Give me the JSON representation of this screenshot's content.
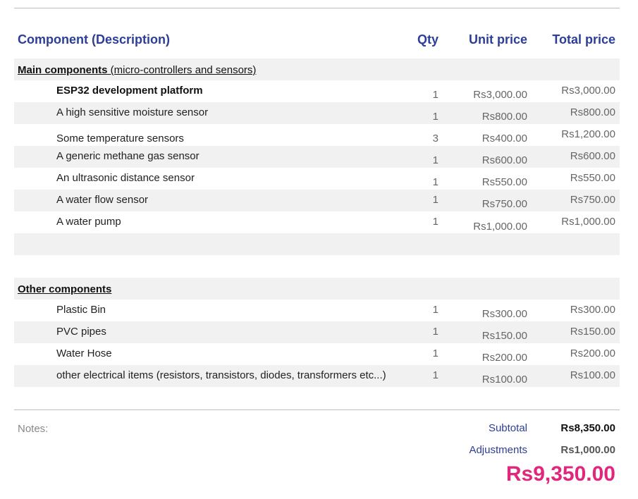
{
  "header": {
    "description": "Component (Description)",
    "qty": "Qty",
    "unit_price": "Unit price",
    "total_price": "Total price"
  },
  "sections": [
    {
      "title_bold": "Main components",
      "title_rest": " (micro-controllers and sensors)",
      "items": [
        {
          "description": "ESP32 development platform",
          "qty": "1",
          "unit": "Rs3,000.00",
          "total": "Rs3,000.00"
        },
        {
          "description": "A high sensitive moisture sensor",
          "qty": "1",
          "unit": "Rs800.00",
          "total": "Rs800.00"
        },
        {
          "description": "Some temperature sensors",
          "qty": "3",
          "unit": "Rs400.00",
          "total": "Rs1,200.00"
        },
        {
          "description": "A generic methane gas sensor",
          "qty": "1",
          "unit": "Rs600.00",
          "total": "Rs600.00"
        },
        {
          "description": "An ultrasonic distance sensor",
          "qty": "1",
          "unit": "Rs550.00",
          "total": "Rs550.00"
        },
        {
          "description": "A water flow sensor",
          "qty": "1",
          "unit": "Rs750.00",
          "total": "Rs750.00"
        },
        {
          "description": "A water pump",
          "qty": "1",
          "unit": "Rs1,000.00",
          "total": "Rs1,000.00"
        }
      ]
    },
    {
      "title_bold": "Other components",
      "title_rest": "",
      "items": [
        {
          "description": "Plastic Bin",
          "qty": "1",
          "unit": "Rs300.00",
          "total": "Rs300.00"
        },
        {
          "description": "PVC pipes",
          "qty": "1",
          "unit": "Rs150.00",
          "total": "Rs150.00"
        },
        {
          "description": "Water Hose",
          "qty": "1",
          "unit": "Rs200.00",
          "total": "Rs200.00"
        },
        {
          "description": "other electrical items (resistors, transistors, diodes, transformers etc...)",
          "qty": "1",
          "unit": "Rs100.00",
          "total": "Rs100.00"
        }
      ]
    }
  ],
  "footer": {
    "notes_label": "Notes:",
    "subtotal_label": "Subtotal",
    "subtotal_value": "Rs8,350.00",
    "adjustments_label": "Adjustments",
    "adjustments_value": "Rs1,000.00",
    "grand_total": "Rs9,350.00"
  },
  "colors": {
    "header_text": "#2d3e96",
    "grand_total": "#e0267d",
    "row_shade": "#f1f1f1"
  }
}
